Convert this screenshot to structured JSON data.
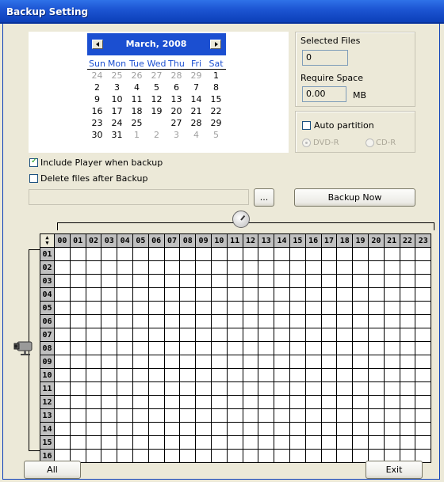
{
  "window": {
    "title": "Backup Setting"
  },
  "calendar": {
    "month_label": "March, 2008",
    "days_of_week": [
      "Sun",
      "Mon",
      "Tue",
      "Wed",
      "Thu",
      "Fri",
      "Sat"
    ],
    "weeks": [
      [
        {
          "d": "24",
          "o": true
        },
        {
          "d": "25",
          "o": true
        },
        {
          "d": "26",
          "o": true
        },
        {
          "d": "27",
          "o": true
        },
        {
          "d": "28",
          "o": true
        },
        {
          "d": "29",
          "o": true
        },
        {
          "d": "1"
        }
      ],
      [
        {
          "d": "2"
        },
        {
          "d": "3"
        },
        {
          "d": "4"
        },
        {
          "d": "5"
        },
        {
          "d": "6"
        },
        {
          "d": "7"
        },
        {
          "d": "8"
        }
      ],
      [
        {
          "d": "9"
        },
        {
          "d": "10"
        },
        {
          "d": "11"
        },
        {
          "d": "12"
        },
        {
          "d": "13"
        },
        {
          "d": "14"
        },
        {
          "d": "15"
        }
      ],
      [
        {
          "d": "16"
        },
        {
          "d": "17"
        },
        {
          "d": "18"
        },
        {
          "d": "19"
        },
        {
          "d": "20"
        },
        {
          "d": "21"
        },
        {
          "d": "22"
        }
      ],
      [
        {
          "d": "23"
        },
        {
          "d": "24"
        },
        {
          "d": "25"
        },
        {
          "d": "26",
          "s": true
        },
        {
          "d": "27"
        },
        {
          "d": "28"
        },
        {
          "d": "29"
        }
      ],
      [
        {
          "d": "30"
        },
        {
          "d": "31"
        },
        {
          "d": "1",
          "o": true
        },
        {
          "d": "2",
          "o": true
        },
        {
          "d": "3",
          "o": true
        },
        {
          "d": "4",
          "o": true
        },
        {
          "d": "5",
          "o": true
        }
      ]
    ],
    "colors": {
      "header": "#1b4fd1",
      "selected_ring": "#e01010"
    }
  },
  "summary": {
    "selected_files_label": "Selected Files",
    "selected_files_value": "0",
    "require_space_label": "Require Space",
    "require_space_value": "0.00",
    "require_space_unit": "MB"
  },
  "partition": {
    "auto_partition_label": "Auto partition",
    "dvd_label": "DVD-R",
    "cd_label": "CD-R"
  },
  "options": {
    "include_player_label": "Include Player when backup",
    "delete_files_label": "Delete files after Backup"
  },
  "path": {
    "browse_label": "...",
    "value": ""
  },
  "backup_now_label": "Backup Now",
  "schedule": {
    "hours": [
      "00",
      "01",
      "02",
      "03",
      "04",
      "05",
      "06",
      "07",
      "08",
      "09",
      "10",
      "11",
      "12",
      "13",
      "14",
      "15",
      "16",
      "17",
      "18",
      "19",
      "20",
      "21",
      "22",
      "23"
    ],
    "channels": [
      "01",
      "02",
      "03",
      "04",
      "05",
      "06",
      "07",
      "08",
      "09",
      "10",
      "11",
      "12",
      "13",
      "14",
      "15",
      "16"
    ]
  },
  "footer": {
    "all_label": "All",
    "exit_label": "Exit"
  }
}
